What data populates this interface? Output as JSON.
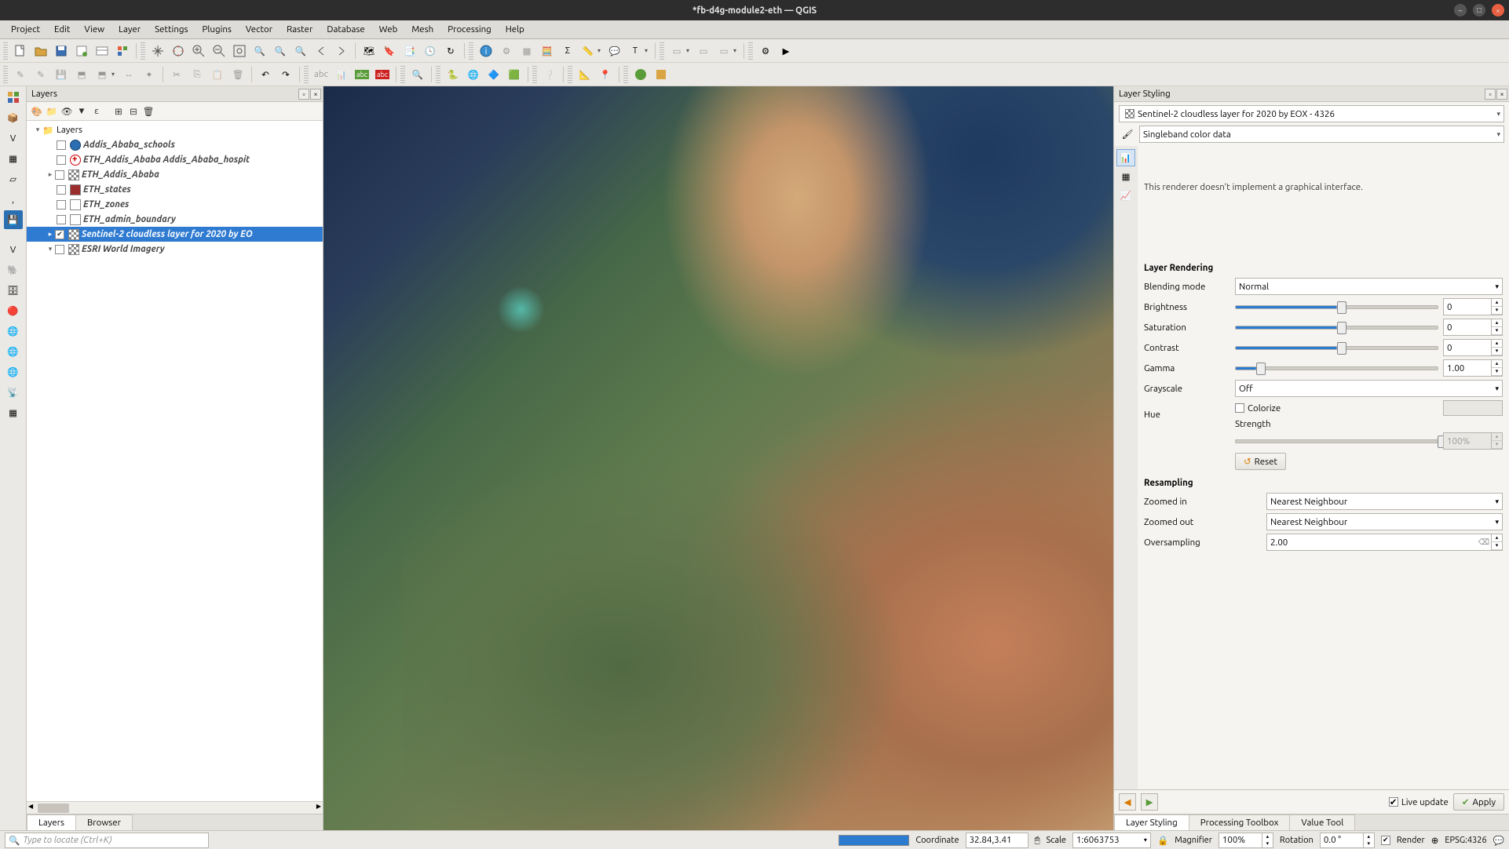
{
  "window": {
    "title": "*fb-d4g-module2-eth — QGIS"
  },
  "menu": [
    "Project",
    "Edit",
    "View",
    "Layer",
    "Settings",
    "Plugins",
    "Vector",
    "Raster",
    "Database",
    "Web",
    "Mesh",
    "Processing",
    "Help"
  ],
  "panels": {
    "layers_title": "Layers",
    "layer_styling_title": "Layer Styling",
    "bottom_tabs": {
      "layers": "Layers",
      "browser": "Browser"
    },
    "right_tabs": {
      "styling": "Layer Styling",
      "toolbox": "Processing Toolbox",
      "valuetool": "Value Tool"
    }
  },
  "layers": {
    "root": "Layers",
    "items": [
      {
        "name": "Addis_Ababa_schools",
        "type": "point",
        "checked": false
      },
      {
        "name": "ETH_Addis_Ababa Addis_Ababa_hospit",
        "type": "hosp",
        "checked": false
      },
      {
        "name": "ETH_Addis_Ababa",
        "type": "raster",
        "checked": false,
        "expandable": true
      },
      {
        "name": "ETH_states",
        "type": "states",
        "checked": false
      },
      {
        "name": "ETH_zones",
        "type": "zones",
        "checked": false
      },
      {
        "name": "ETH_admin_boundary",
        "type": "admin",
        "checked": false
      },
      {
        "name": "Sentinel-2 cloudless layer for 2020 by EO",
        "type": "raster",
        "checked": true,
        "selected": true,
        "expandable": true
      },
      {
        "name": "ESRI World Imagery",
        "type": "raster",
        "checked": false
      }
    ]
  },
  "styling": {
    "current_layer": "Sentinel-2 cloudless layer for 2020 by EOX - 4326",
    "renderer": "Singleband color data",
    "msg": "This renderer doesn't implement a graphical interface.",
    "sec_rendering": "Layer Rendering",
    "blending_label": "Blending mode",
    "blending_value": "Normal",
    "brightness_label": "Brightness",
    "brightness_value": "0",
    "saturation_label": "Saturation",
    "saturation_value": "0",
    "contrast_label": "Contrast",
    "contrast_value": "0",
    "gamma_label": "Gamma",
    "gamma_value": "1.00",
    "grayscale_label": "Grayscale",
    "grayscale_value": "Off",
    "hue_label": "Hue",
    "colorize_label": "Colorize",
    "strength_label": "Strength",
    "strength_value": "100%",
    "reset_label": "Reset",
    "sec_resampling": "Resampling",
    "zoomin_label": "Zoomed in",
    "zoomin_value": "Nearest Neighbour",
    "zoomout_label": "Zoomed out",
    "zoomout_value": "Nearest Neighbour",
    "oversampling_label": "Oversampling",
    "oversampling_value": "2.00",
    "live_update": "Live update",
    "apply": "Apply"
  },
  "status": {
    "locator_placeholder": "Type to locate (Ctrl+K)",
    "coord_label": "Coordinate",
    "coord_value": "32.84,3.41",
    "scale_label": "Scale",
    "scale_value": "1:6063753",
    "magnifier_label": "Magnifier",
    "magnifier_value": "100%",
    "rotation_label": "Rotation",
    "rotation_value": "0.0 °",
    "render_label": "Render",
    "crs": "EPSG:4326"
  }
}
